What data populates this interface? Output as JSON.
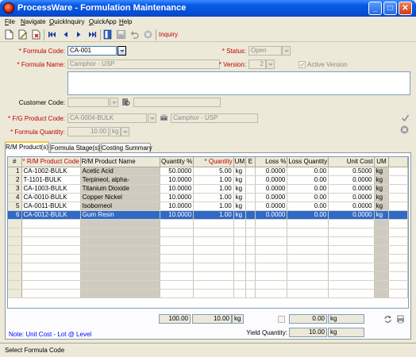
{
  "window": {
    "title": "ProcessWare - Formulation Maintenance"
  },
  "menu": [
    "File",
    "Navigate",
    "QuickInquiry",
    "QuickApp",
    "Help"
  ],
  "toolbar": {
    "inquiry_label": "Inquiry"
  },
  "form": {
    "formula_code": {
      "label": "* Formula Code:",
      "value": "CA-001"
    },
    "status": {
      "label": "* Status:",
      "value": "Open"
    },
    "formula_name": {
      "label": "* Formula Name:",
      "value": "Camphor - USP"
    },
    "version": {
      "label": "* Version:",
      "value": "2"
    },
    "active_version": {
      "label": "Active Version"
    },
    "customer_code": {
      "label": "Customer Code:",
      "value": ""
    },
    "fg_product_code": {
      "label": "* F/G Product Code:",
      "value": "CA-0004-BULK",
      "description": "Camphor - USP"
    },
    "formula_quantity": {
      "label": "* Formula Quantity:",
      "value": "10.00",
      "unit": "kg"
    }
  },
  "tabs": [
    "R/M Product(s)",
    "Formula Stage(s)",
    "Costing Summary"
  ],
  "grid": {
    "columns": [
      "#",
      "* R/M Product Code",
      "R/M Product Name",
      "Quantity %",
      "* Quantity",
      "UM",
      "E",
      "Loss %",
      "Loss Quantity",
      "Unit Cost",
      "UM"
    ],
    "rows": [
      [
        "1",
        "CA-1002-BULK",
        "Acetic Acid",
        "50.0000",
        "5.00",
        "kg",
        "",
        "0.0000",
        "0.00",
        "0.5000",
        "kg"
      ],
      [
        "2",
        "T-1101-BULK",
        "Terpineol, alpha-",
        "10.0000",
        "1.00",
        "kg",
        "",
        "0.0000",
        "0.00",
        "0.0000",
        "kg"
      ],
      [
        "3",
        "CA-1003-BULK",
        "Titanium Dioxide",
        "10.0000",
        "1.00",
        "kg",
        "",
        "0.0000",
        "0.00",
        "0.0000",
        "kg"
      ],
      [
        "4",
        "CA-0010-BULK",
        "Copper Nickel",
        "10.0000",
        "1.00",
        "kg",
        "",
        "0.0000",
        "0.00",
        "0.0000",
        "kg"
      ],
      [
        "5",
        "CA-0011-BULK",
        "Isoborneol",
        "10.0000",
        "1.00",
        "kg",
        "",
        "0.0000",
        "0.00",
        "0.0000",
        "kg"
      ],
      [
        "6",
        "CA-0012-BULK",
        "Gum Resin",
        "10.0000",
        "1.00",
        "kg",
        "",
        "0.0000",
        "0.00",
        "0.0000",
        "kg"
      ]
    ],
    "selected_row": 6
  },
  "totals": {
    "quantity_pct": "100.00",
    "quantity": "10.00",
    "quantity_um": "kg",
    "loss_quantity": "0.00",
    "loss_um": "kg",
    "yield_label": "Yield Quantity:",
    "yield_value": "10.00",
    "yield_um": "kg"
  },
  "note": "Note: Unit Cost - Lot @ Level",
  "status_bar": "Select Formula Code"
}
